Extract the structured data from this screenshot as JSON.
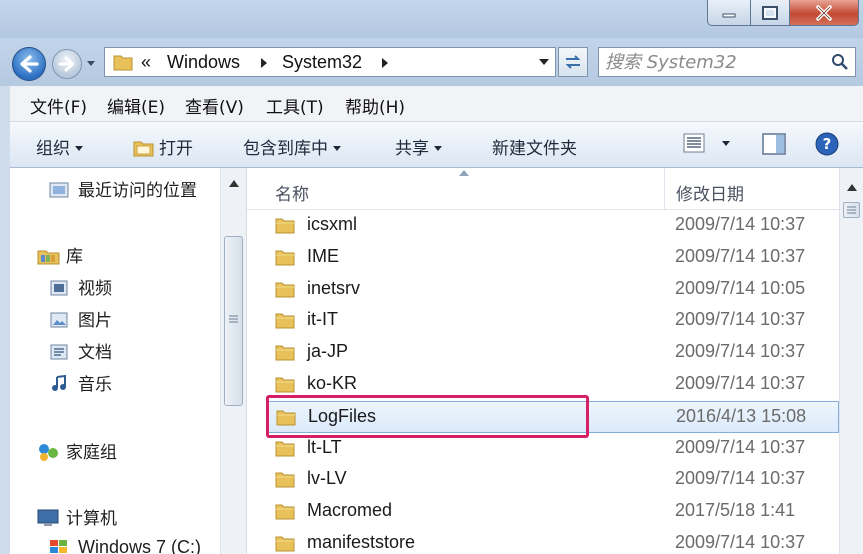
{
  "address": {
    "path": [
      "Windows",
      "System32"
    ],
    "back_chevrons": "«"
  },
  "search": {
    "placeholder": "搜索 System32"
  },
  "menubar": [
    "文件(F)",
    "编辑(E)",
    "查看(V)",
    "工具(T)",
    "帮助(H)"
  ],
  "toolbar": {
    "organize": "组织",
    "open": "打开",
    "include_library": "包含到库中",
    "share": "共享",
    "new_folder": "新建文件夹"
  },
  "nav": {
    "recent": "最近访问的位置",
    "libraries": "库",
    "videos": "视频",
    "pictures": "图片",
    "documents": "文档",
    "music": "音乐",
    "homegroup": "家庭组",
    "computer": "计算机",
    "drive_c": "Windows 7 (C:)"
  },
  "columns": {
    "name": "名称",
    "modified": "修改日期"
  },
  "files": [
    {
      "name": "icsxml",
      "modified": "2009/7/14 10:37"
    },
    {
      "name": "IME",
      "modified": "2009/7/14 10:37"
    },
    {
      "name": "inetsrv",
      "modified": "2009/7/14 10:05"
    },
    {
      "name": "it-IT",
      "modified": "2009/7/14 10:37"
    },
    {
      "name": "ja-JP",
      "modified": "2009/7/14 10:37"
    },
    {
      "name": "ko-KR",
      "modified": "2009/7/14 10:37"
    },
    {
      "name": "LogFiles",
      "modified": "2016/4/13 15:08"
    },
    {
      "name": "lt-LT",
      "modified": "2009/7/14 10:37"
    },
    {
      "name": "lv-LV",
      "modified": "2009/7/14 10:37"
    },
    {
      "name": "Macromed",
      "modified": "2017/5/18 1:41"
    },
    {
      "name": "manifeststore",
      "modified": "2009/7/14 10:37"
    }
  ],
  "selected_file": "LogFiles",
  "colors": {
    "highlight_box": "#d61f64",
    "selection": "#dbeafb",
    "folder": "#e8c15a"
  }
}
